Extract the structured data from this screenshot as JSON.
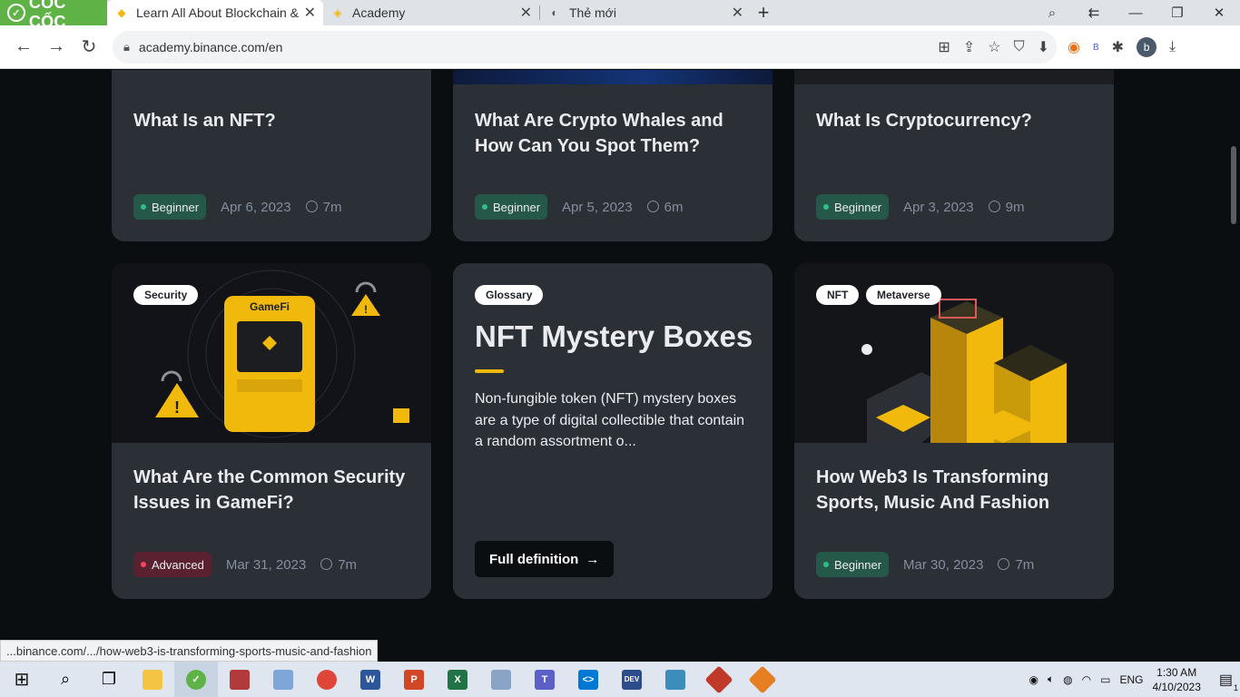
{
  "browser": {
    "brand": "CỐC CỐC",
    "tabs": [
      {
        "label": "Learn All About Blockchain &",
        "active": true
      },
      {
        "label": "Academy",
        "active": false
      },
      {
        "label": "Thẻ mới",
        "active": false
      }
    ],
    "url": "academy.binance.com/en",
    "status_url": "...binance.com/.../how-web3-is-transforming-sports-music-and-fashion",
    "avatar_letter": "b"
  },
  "cards_top": [
    {
      "title": "What Is an NFT?",
      "level": "Beginner",
      "date": "Apr 6, 2023",
      "read": "7m"
    },
    {
      "title": "What Are Crypto Whales and How Can You Spot Them?",
      "level": "Beginner",
      "date": "Apr 5, 2023",
      "read": "6m"
    },
    {
      "title": "What Is Cryptocurrency?",
      "level": "Beginner",
      "date": "Apr 3, 2023",
      "read": "9m"
    }
  ],
  "card_gamefi": {
    "tag": "Security",
    "image_text": "GameFi",
    "title": "What Are the Common Security Issues in GameFi?",
    "level": "Advanced",
    "date": "Mar 31, 2023",
    "read": "7m"
  },
  "glossary": {
    "tag": "Glossary",
    "title": "NFT Mystery Boxes",
    "description": "Non-fungible token (NFT) mystery boxes are a type of digital collectible that contain a random assortment o...",
    "button": "Full definition"
  },
  "card_web3": {
    "tags": [
      "NFT",
      "Metaverse"
    ],
    "title": "How Web3 Is Transforming Sports, Music And Fashion",
    "level": "Beginner",
    "date": "Mar 30, 2023",
    "read": "7m"
  },
  "taskbar": {
    "lang": "ENG",
    "time": "1:30 AM",
    "date": "4/10/2023",
    "notifications": "1"
  },
  "colors": {
    "page_bg": "#0b0e11",
    "card_bg": "#2b2f36",
    "accent": "#f0b90b",
    "beginner": "#2ebd85",
    "advanced": "#f6465d"
  }
}
